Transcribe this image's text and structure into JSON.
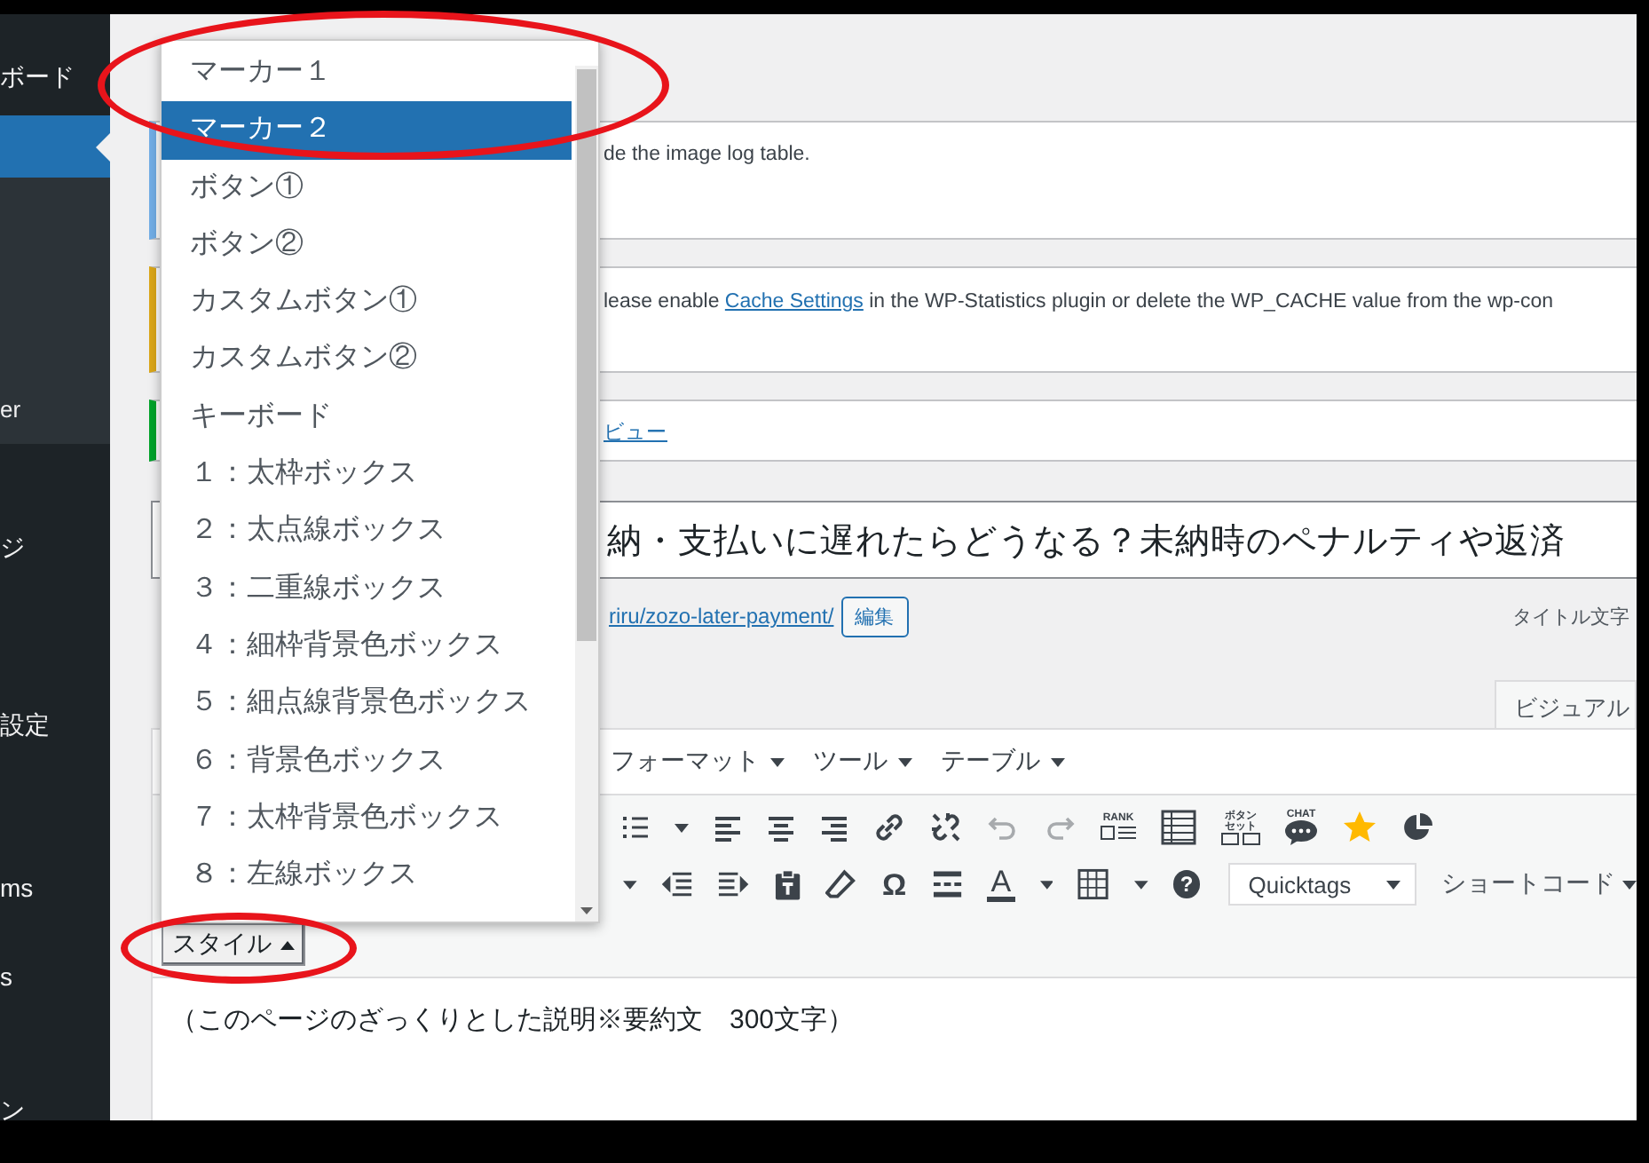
{
  "sidebar": {
    "items": [
      {
        "label": "ボード",
        "kind": "top",
        "selected": false
      },
      {
        "kind": "top",
        "selected": true
      },
      {
        "label": "er",
        "kind": "sub",
        "selected": false
      },
      {
        "label": "ジ",
        "kind": "top",
        "selected": false
      },
      {
        "label": "設定",
        "kind": "top",
        "selected": false
      },
      {
        "label": "ms",
        "kind": "top",
        "selected": false
      },
      {
        "label": "s",
        "kind": "top",
        "selected": false
      },
      {
        "label": "ン",
        "kind": "top",
        "selected": false
      }
    ]
  },
  "notices": [
    {
      "color": "#72aee6",
      "text": "de the image log table."
    },
    {
      "color": "#dba617",
      "text": "lease enable",
      "link": "Cache Settings",
      "text_after": "in the WP-Statistics plugin or delete the WP_CACHE value from the wp-con"
    },
    {
      "color": "#00a32a",
      "link": "ビュー"
    }
  ],
  "title_field": {
    "value": "納・支払いに遅れたらどうなる？未納時のペナルティや返済"
  },
  "permalink": {
    "url": "riru/zozo-later-payment/",
    "edit_button": "編集",
    "title_count_label": "タイトル文字"
  },
  "editor_tab": {
    "label": "ビジュアル",
    "selected": true
  },
  "toolbar": {
    "menus": [
      "フォーマット",
      "ツール",
      "テーブル"
    ],
    "rank_icon": "RANK",
    "button_set_icon": [
      "ボタン",
      "セット"
    ],
    "chat_icon": "CHAT",
    "special_char_icon": "Ω",
    "text_color_icon": "A",
    "help_icon": "?",
    "quicktags": "Quicktags",
    "shortcode_menu": "ショートコード",
    "style_button": "スタイル"
  },
  "editor_content": "（このページのざっくりとした説明※要約文　300文字）",
  "style_dropdown": {
    "items": [
      {
        "label": "マーカー１",
        "selected": false
      },
      {
        "label": "マーカー２",
        "selected": true
      },
      {
        "label": "ボタン①",
        "selected": false
      },
      {
        "label": "ボタン②",
        "selected": false
      },
      {
        "label": "カスタムボタン①",
        "selected": false
      },
      {
        "label": "カスタムボタン②",
        "selected": false
      },
      {
        "label": "キーボード",
        "selected": false
      },
      {
        "label": "１：太枠ボックス",
        "selected": false
      },
      {
        "label": "２：太点線ボックス",
        "selected": false
      },
      {
        "label": "３：二重線ボックス",
        "selected": false
      },
      {
        "label": "４：細枠背景色ボックス",
        "selected": false
      },
      {
        "label": "５：細点線背景色ボックス",
        "selected": false
      },
      {
        "label": "６：背景色ボックス",
        "selected": false
      },
      {
        "label": "７：太枠背景色ボックス",
        "selected": false
      },
      {
        "label": "８：左線ボックス",
        "selected": false
      }
    ]
  },
  "annotations": [
    {
      "kind": "ellipse"
    },
    {
      "kind": "ellipse"
    }
  ]
}
